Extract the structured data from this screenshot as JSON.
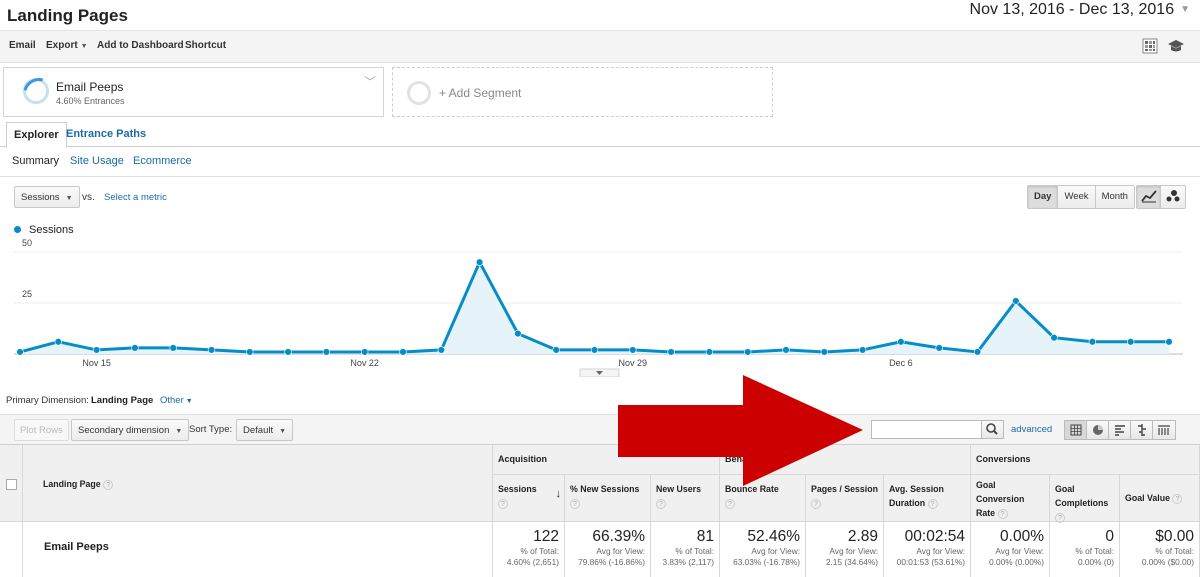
{
  "header": {
    "title": "Landing Pages",
    "date_range": "Nov 13, 2016 - Dec 13, 2016"
  },
  "toolbar": {
    "email": "Email",
    "export": "Export",
    "add_dashboard": "Add to Dashboard",
    "shortcut": "Shortcut"
  },
  "segments": {
    "active": {
      "name": "Email Peeps",
      "sub": "4.60% Entrances"
    },
    "add_label": "+ Add Segment"
  },
  "tabs": {
    "explorer": "Explorer",
    "entrance_paths": "Entrance Paths"
  },
  "subtabs": {
    "summary": "Summary",
    "site_usage": "Site Usage",
    "ecommerce": "Ecommerce"
  },
  "controls": {
    "metric": "Sessions",
    "vs": "vs.",
    "select_metric": "Select a metric",
    "periods": [
      "Day",
      "Week",
      "Month"
    ],
    "active_period": "Day"
  },
  "chart_data": {
    "type": "area",
    "series": [
      {
        "name": "Sessions",
        "color": "#058dc7",
        "values": [
          1,
          6,
          2,
          3,
          3,
          2,
          1,
          1,
          1,
          1,
          1,
          2,
          45,
          10,
          2,
          2,
          2,
          1,
          1,
          1,
          2,
          1,
          2,
          6,
          3,
          1,
          26,
          8,
          6,
          6,
          6
        ]
      }
    ],
    "x": [
      "Nov 13",
      "Nov 14",
      "Nov 15",
      "Nov 16",
      "Nov 17",
      "Nov 18",
      "Nov 19",
      "Nov 20",
      "Nov 21",
      "Nov 22",
      "Nov 23",
      "Nov 24",
      "Nov 25",
      "Nov 26",
      "Nov 27",
      "Nov 28",
      "Nov 29",
      "Nov 30",
      "Dec 1",
      "Dec 2",
      "Dec 3",
      "Dec 4",
      "Dec 5",
      "Dec 6",
      "Dec 7",
      "Dec 8",
      "Dec 9",
      "Dec 10",
      "Dec 11",
      "Dec 12",
      "Dec 13"
    ],
    "x_tick_labels": [
      "Nov 15",
      "Nov 22",
      "Nov 29",
      "Dec 6"
    ],
    "y_tick_labels": [
      "50",
      "25"
    ],
    "ylim": [
      0,
      50
    ],
    "grid": true,
    "legend": "top-left"
  },
  "dimensions": {
    "primary_label": "Primary Dimension:",
    "landing_page": "Landing Page",
    "other": "Other"
  },
  "table_toolbar": {
    "plot_rows": "Plot Rows",
    "secondary_dimension": "Secondary dimension",
    "sort_type_label": "Sort Type:",
    "sort_default": "Default",
    "advanced": "advanced"
  },
  "table": {
    "group_headers": {
      "acquisition": "Acquisition",
      "behavior": "Behavior",
      "conversions": "Conversions"
    },
    "dimension_header": "Landing Page",
    "columns": [
      "Sessions",
      "% New Sessions",
      "New Users",
      "Bounce Rate",
      "Pages / Session",
      "Avg. Session Duration",
      "Goal Conversion Rate",
      "Goal Completions",
      "Goal Value"
    ],
    "total_row": {
      "label": "Email Peeps",
      "cells": [
        {
          "value": "122",
          "sub1": "% of Total:",
          "sub2": "4.60% (2,651)"
        },
        {
          "value": "66.39%",
          "sub1": "Avg for View:",
          "sub2": "79.86% (-16.86%)"
        },
        {
          "value": "81",
          "sub1": "% of Total:",
          "sub2": "3.83% (2,117)"
        },
        {
          "value": "52.46%",
          "sub1": "Avg for View:",
          "sub2": "63.03% (-16.78%)"
        },
        {
          "value": "2.89",
          "sub1": "Avg for View:",
          "sub2": "2.15 (34.64%)"
        },
        {
          "value": "00:02:54",
          "sub1": "Avg for View:",
          "sub2": "00:01:53 (53.61%)"
        },
        {
          "value": "0.00%",
          "sub1": "Avg for View:",
          "sub2": "0.00% (0.00%)"
        },
        {
          "value": "0",
          "sub1": "% of Total:",
          "sub2": "0.00% (0)"
        },
        {
          "value": "$0.00",
          "sub1": "% of Total:",
          "sub2": "0.00% ($0.00)"
        }
      ]
    }
  },
  "colors": {
    "link": "#1a6aa8",
    "series": "#058dc7",
    "annotation_arrow": "#cc0000"
  }
}
